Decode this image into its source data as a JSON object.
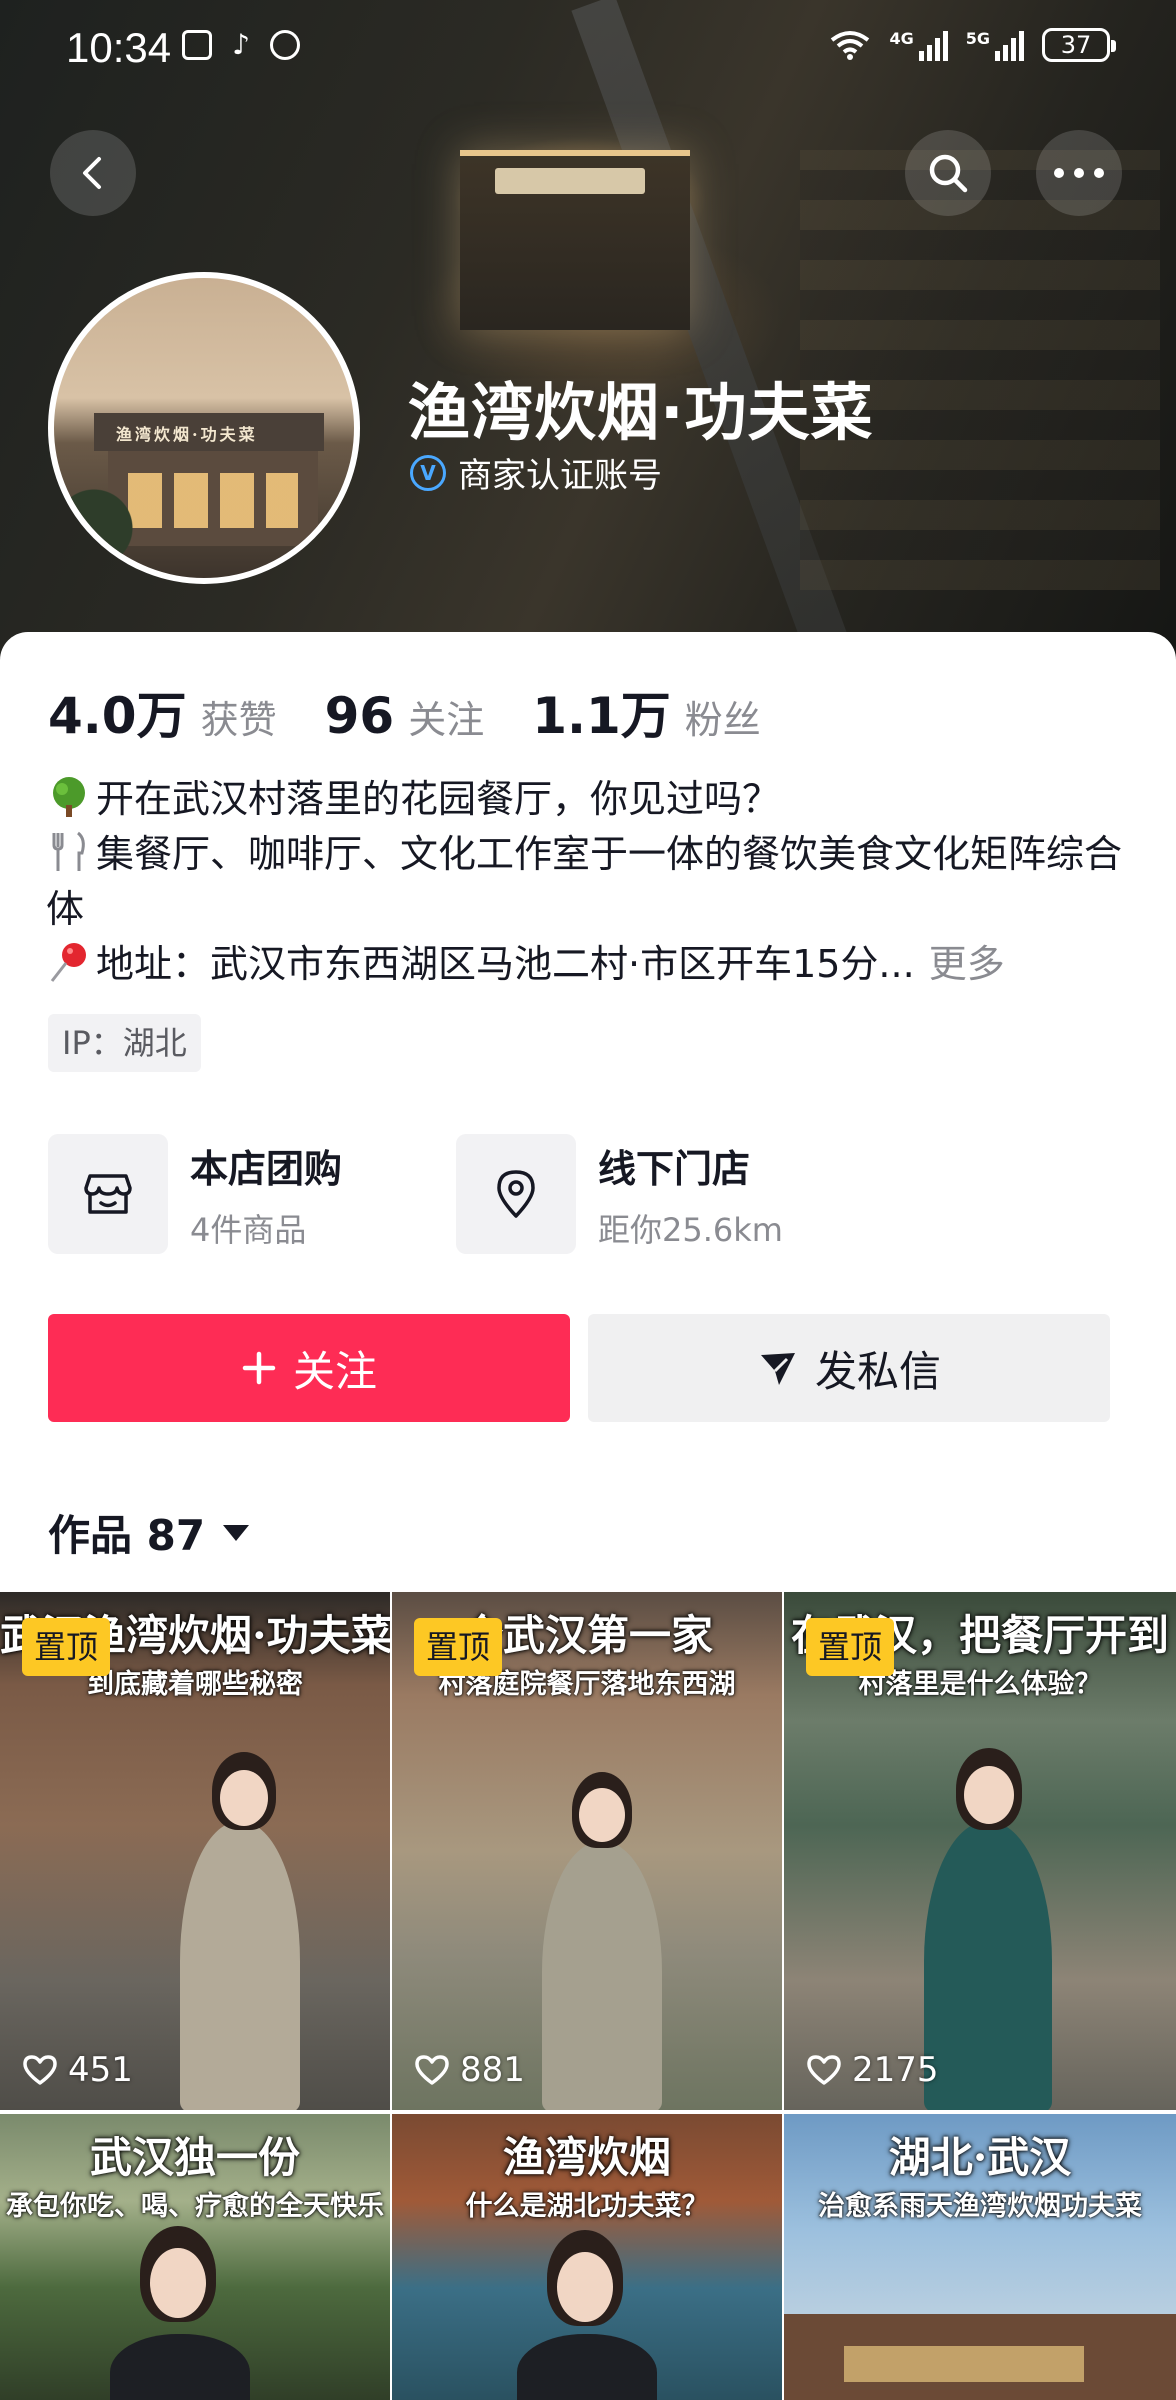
{
  "status_bar": {
    "time": "10:34",
    "network_1": "4G",
    "network_2": "5G",
    "battery": "37"
  },
  "header": {
    "back_icon": "chevron-left-icon",
    "search_icon": "search-icon",
    "more_icon": "more-dots-icon"
  },
  "profile": {
    "name": "渔湾炊烟·功夫菜",
    "verification": "商家认证账号",
    "avatar_sign": "渔湾炊烟·功夫菜",
    "stats": [
      {
        "value": "4.0万",
        "label": "获赞"
      },
      {
        "value": "96",
        "label": "关注"
      },
      {
        "value": "1.1万",
        "label": "粉丝"
      }
    ],
    "bio": {
      "line1": "开在武汉村落里的花园餐厅，你见过吗？",
      "line2": "集餐厅、咖啡厅、文化工作室于一体的餐饮美食文化矩阵综合体",
      "line3": "地址：武汉市东西湖区马池二村·市区开车15分...",
      "more": "更多"
    },
    "ip": "IP：湖北"
  },
  "services": {
    "shop": {
      "title": "本店团购",
      "subtitle": "4件商品",
      "icon": "shop-icon"
    },
    "store": {
      "title": "线下门店",
      "subtitle": "距你25.6km",
      "icon": "location-pin-icon"
    }
  },
  "actions": {
    "follow": "关注",
    "message": "发私信"
  },
  "works": {
    "tab_label": "作品 87",
    "pin_label": "置顶",
    "items": [
      {
        "title": "武汉渔湾炊烟·功夫菜",
        "subtitle": "到底藏着哪些秘密",
        "likes": "451",
        "pinned": true
      },
      {
        "title": "全武汉第一家",
        "subtitle": "村落庭院餐厅落地东西湖",
        "likes": "881",
        "pinned": true
      },
      {
        "title": "在武汉，把餐厅开到",
        "subtitle": "村落里是什么体验？",
        "likes": "2175",
        "pinned": true
      },
      {
        "title": "武汉独一份",
        "subtitle": "承包你吃、喝、疗愈的全天快乐",
        "likes": "",
        "pinned": false
      },
      {
        "title": "渔湾炊烟",
        "subtitle": "什么是湖北功夫菜？",
        "likes": "",
        "pinned": false
      },
      {
        "title": "湖北·武汉",
        "subtitle": "治愈系雨天渔湾炊烟功夫菜",
        "likes": "",
        "pinned": false
      }
    ]
  },
  "colors": {
    "accent": "#fe2c55",
    "pin_badge": "#fdc824",
    "verify": "#4aa8ff"
  }
}
